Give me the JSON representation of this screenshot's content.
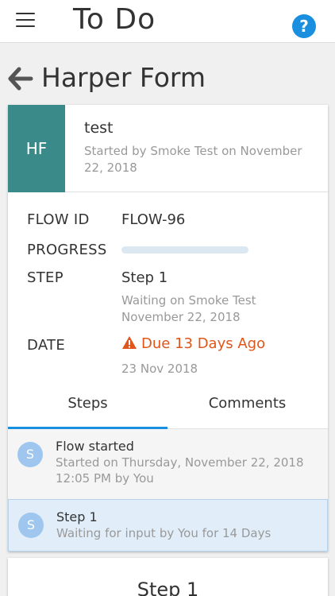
{
  "header": {
    "title": "To Do",
    "menu_icon": "hamburger-menu-icon",
    "help_icon": "help-icon",
    "help_glyph": "?"
  },
  "page": {
    "title": "Harper Form",
    "back_icon": "arrow-left-icon"
  },
  "form": {
    "initials": "HF",
    "name": "test",
    "started": "Started by Smoke Test on November 22, 2018"
  },
  "details": {
    "flow_id_label": "FLOW ID",
    "flow_id_value": "FLOW-96",
    "progress_label": "PROGRESS",
    "progress_fraction": 0,
    "step_label": "STEP",
    "step_value": "Step 1",
    "step_waiting": "Waiting on Smoke Test",
    "step_date": "November 22, 2018",
    "date_label": "DATE",
    "due_text": "Due 13 Days Ago",
    "due_color": "#e0561a",
    "date_value": "23 Nov 2018"
  },
  "tabs": [
    {
      "label": "Steps",
      "active": true
    },
    {
      "label": "Comments",
      "active": false
    }
  ],
  "steps": [
    {
      "initial": "S",
      "title": "Flow started",
      "sub": "Started on Thursday, November 22, 2018 12:05 PM by You"
    },
    {
      "initial": "S",
      "title": "Step 1",
      "sub": "Waiting for input by You for 14 Days"
    }
  ],
  "next_card": {
    "title": "Step 1"
  },
  "colors": {
    "accent": "#1a8fe0",
    "avatar_bg": "#3a8a8a",
    "warning": "#e0561a"
  }
}
